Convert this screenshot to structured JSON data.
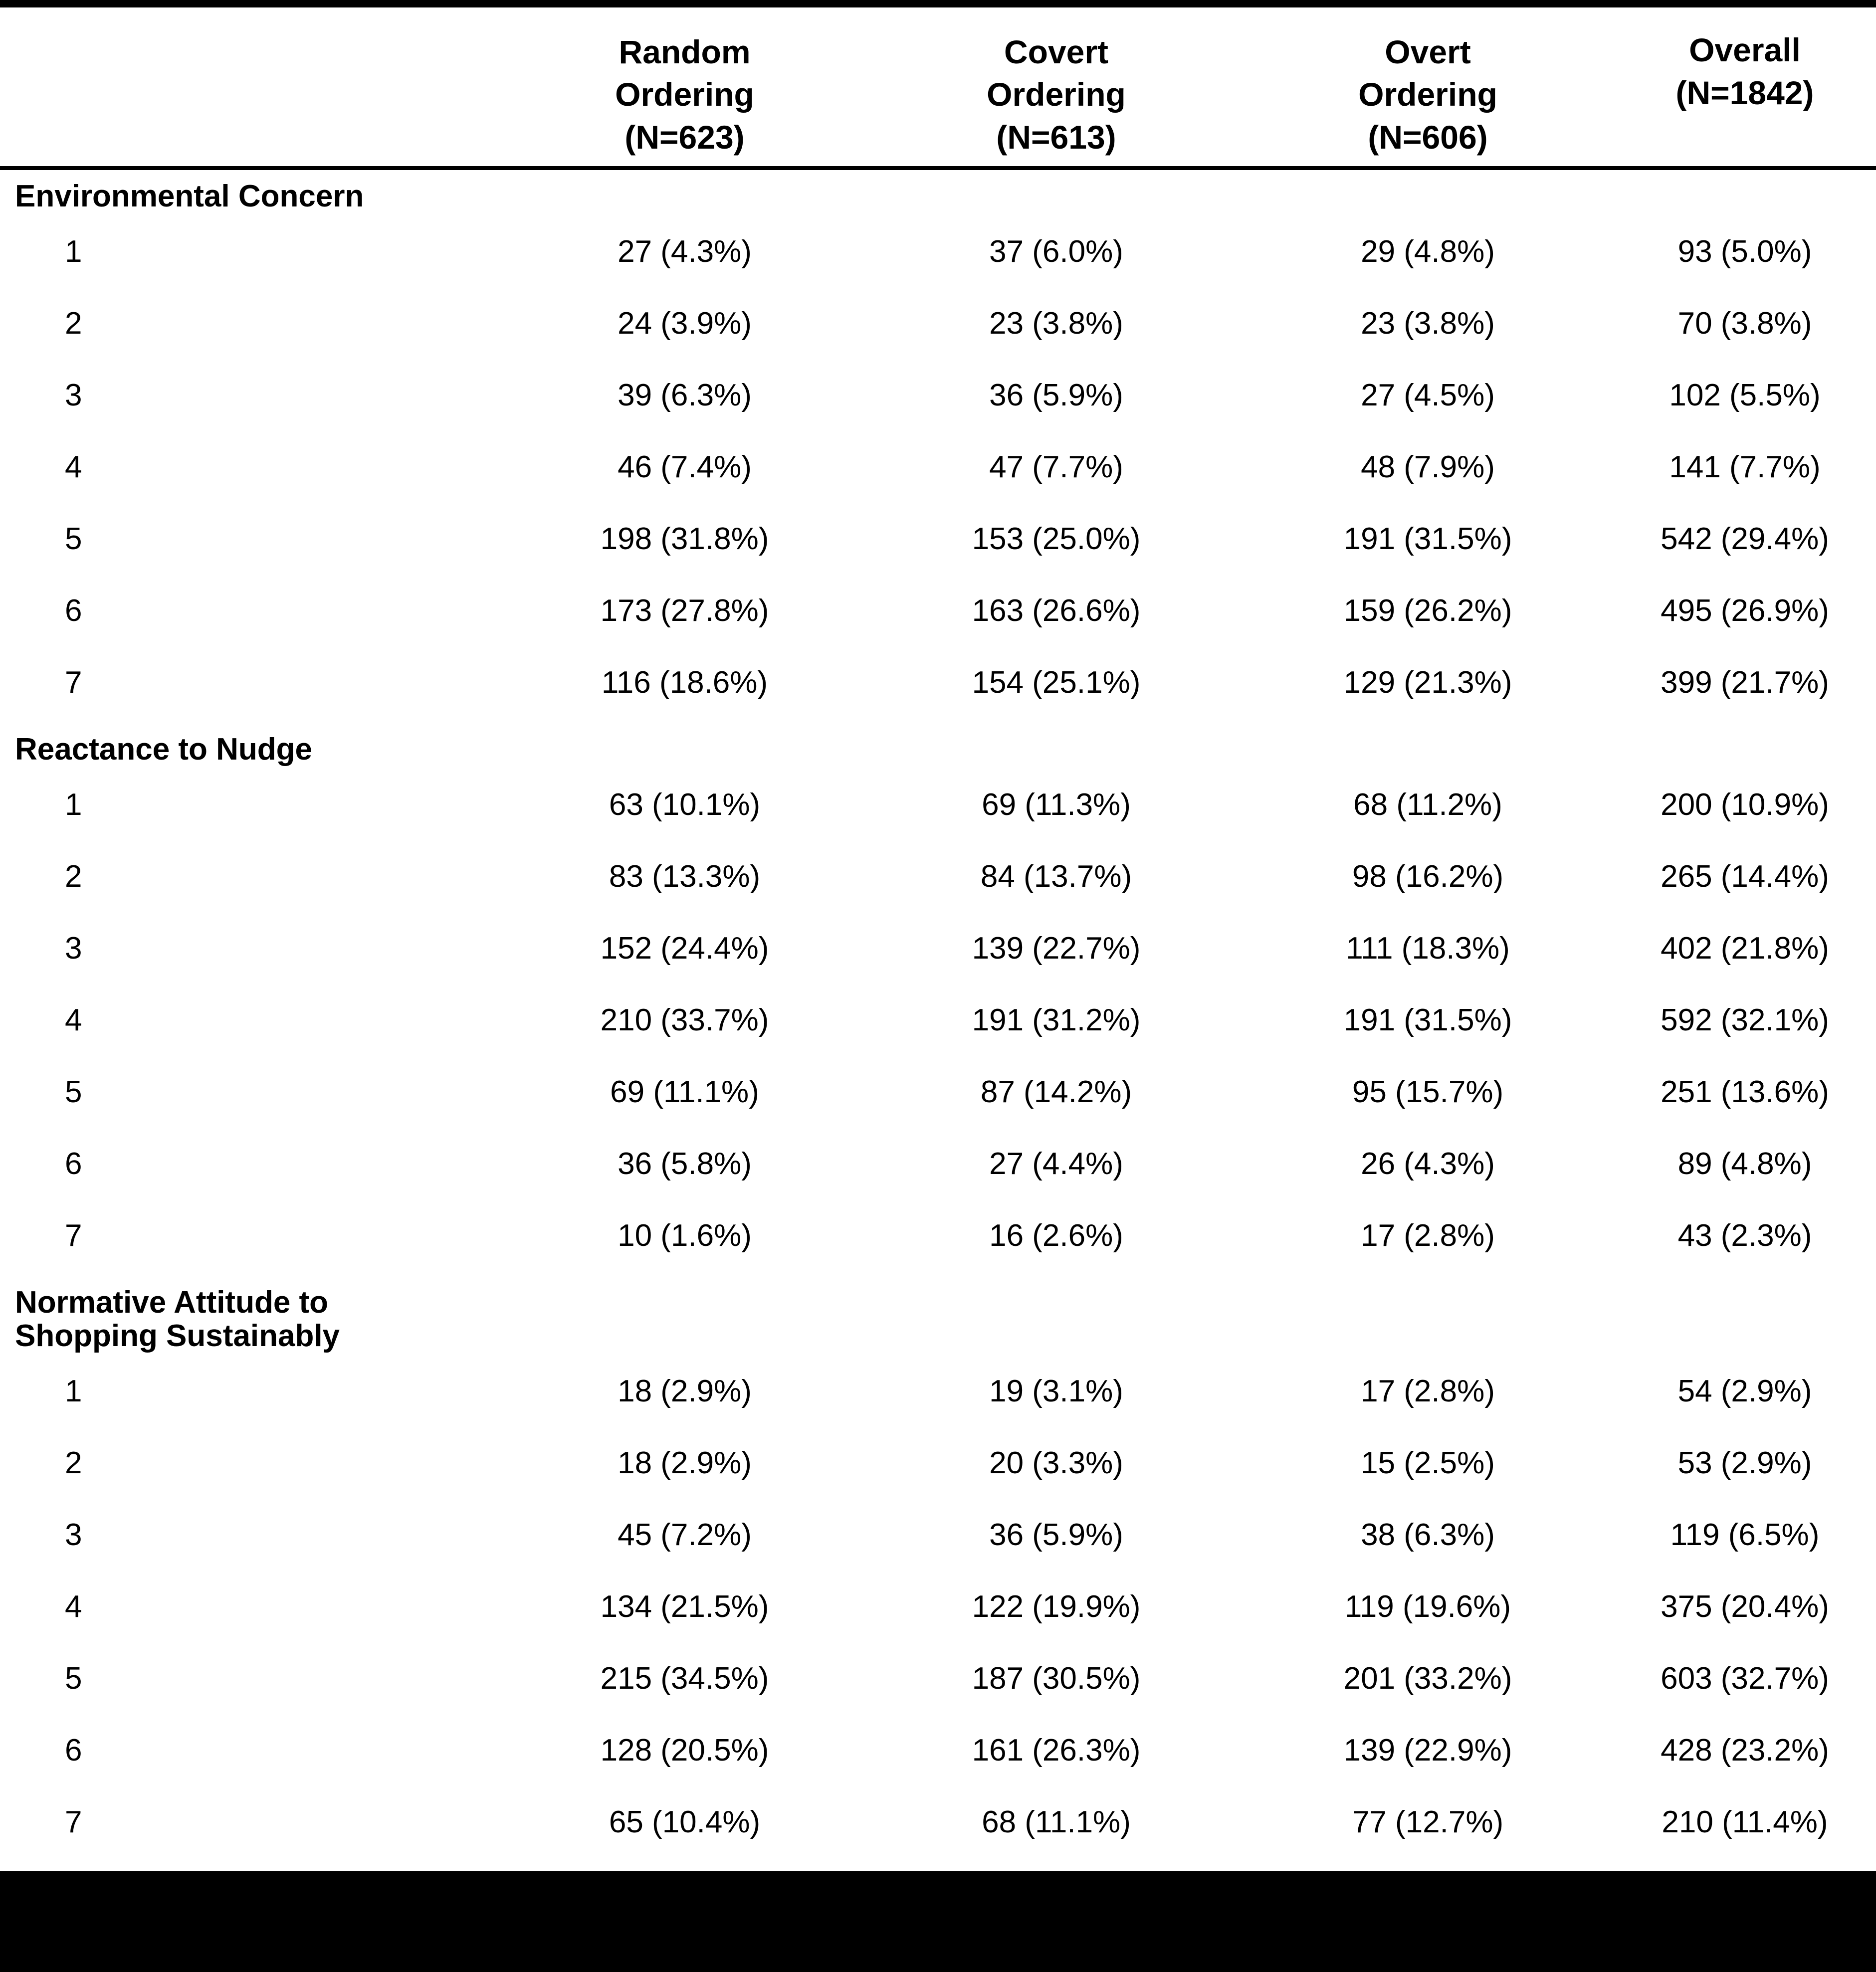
{
  "table": {
    "columns": [
      {
        "id": "label",
        "header_lines": []
      },
      {
        "id": "random",
        "header_lines": [
          "Random",
          "Ordering",
          "(N=623)"
        ]
      },
      {
        "id": "covert",
        "header_lines": [
          "Covert",
          "Ordering",
          "(N=613)"
        ]
      },
      {
        "id": "overt",
        "header_lines": [
          "Overt",
          "Ordering",
          "(N=606)"
        ]
      },
      {
        "id": "overall",
        "header_lines": [
          "Overall",
          "(N=1842)"
        ]
      }
    ],
    "header": {
      "random": {
        "l0": "Random",
        "l1": "Ordering",
        "l2": "(N=623)"
      },
      "covert": {
        "l0": "Covert",
        "l1": "Ordering",
        "l2": "(N=613)"
      },
      "overt": {
        "l0": "Overt",
        "l1": "Ordering",
        "l2": "(N=606)"
      },
      "overall": {
        "l0": "Overall",
        "l1": "(N=1842)"
      }
    },
    "sections": [
      {
        "title_lines": [
          "Environmental Concern"
        ],
        "rows": [
          {
            "label": "1",
            "random": "27 (4.3%)",
            "covert": "37 (6.0%)",
            "overt": "29 (4.8%)",
            "overall": "93 (5.0%)"
          },
          {
            "label": "2",
            "random": "24 (3.9%)",
            "covert": "23 (3.8%)",
            "overt": "23 (3.8%)",
            "overall": "70 (3.8%)"
          },
          {
            "label": "3",
            "random": "39 (6.3%)",
            "covert": "36 (5.9%)",
            "overt": "27 (4.5%)",
            "overall": "102 (5.5%)"
          },
          {
            "label": "4",
            "random": "46 (7.4%)",
            "covert": "47 (7.7%)",
            "overt": "48 (7.9%)",
            "overall": "141 (7.7%)"
          },
          {
            "label": "5",
            "random": "198 (31.8%)",
            "covert": "153 (25.0%)",
            "overt": "191 (31.5%)",
            "overall": "542 (29.4%)"
          },
          {
            "label": "6",
            "random": "173 (27.8%)",
            "covert": "163 (26.6%)",
            "overt": "159 (26.2%)",
            "overall": "495 (26.9%)"
          },
          {
            "label": "7",
            "random": "116 (18.6%)",
            "covert": "154 (25.1%)",
            "overt": "129 (21.3%)",
            "overall": "399 (21.7%)"
          }
        ]
      },
      {
        "title_lines": [
          "Reactance to Nudge"
        ],
        "rows": [
          {
            "label": "1",
            "random": "63 (10.1%)",
            "covert": "69 (11.3%)",
            "overt": "68 (11.2%)",
            "overall": "200 (10.9%)"
          },
          {
            "label": "2",
            "random": "83 (13.3%)",
            "covert": "84 (13.7%)",
            "overt": "98 (16.2%)",
            "overall": "265 (14.4%)"
          },
          {
            "label": "3",
            "random": "152 (24.4%)",
            "covert": "139 (22.7%)",
            "overt": "111 (18.3%)",
            "overall": "402 (21.8%)"
          },
          {
            "label": "4",
            "random": "210 (33.7%)",
            "covert": "191 (31.2%)",
            "overt": "191 (31.5%)",
            "overall": "592 (32.1%)"
          },
          {
            "label": "5",
            "random": "69 (11.1%)",
            "covert": "87 (14.2%)",
            "overt": "95 (15.7%)",
            "overall": "251 (13.6%)"
          },
          {
            "label": "6",
            "random": "36 (5.8%)",
            "covert": "27 (4.4%)",
            "overt": "26 (4.3%)",
            "overall": "89 (4.8%)"
          },
          {
            "label": "7",
            "random": "10 (1.6%)",
            "covert": "16 (2.6%)",
            "overt": "17 (2.8%)",
            "overall": "43 (2.3%)"
          }
        ]
      },
      {
        "title_lines": [
          "Normative Attitude to",
          "Shopping Sustainably"
        ],
        "rows": [
          {
            "label": "1",
            "random": "18 (2.9%)",
            "covert": "19 (3.1%)",
            "overt": "17 (2.8%)",
            "overall": "54 (2.9%)"
          },
          {
            "label": "2",
            "random": "18 (2.9%)",
            "covert": "20 (3.3%)",
            "overt": "15 (2.5%)",
            "overall": "53 (2.9%)"
          },
          {
            "label": "3",
            "random": "45 (7.2%)",
            "covert": "36 (5.9%)",
            "overt": "38 (6.3%)",
            "overall": "119 (6.5%)"
          },
          {
            "label": "4",
            "random": "134 (21.5%)",
            "covert": "122 (19.9%)",
            "overt": "119 (19.6%)",
            "overall": "375 (20.4%)"
          },
          {
            "label": "5",
            "random": "215 (34.5%)",
            "covert": "187 (30.5%)",
            "overt": "201 (33.2%)",
            "overall": "603 (32.7%)"
          },
          {
            "label": "6",
            "random": "128 (20.5%)",
            "covert": "161 (26.3%)",
            "overt": "139 (22.9%)",
            "overall": "428 (23.2%)"
          },
          {
            "label": "7",
            "random": "65 (10.4%)",
            "covert": "68 (11.1%)",
            "overt": "77 (12.7%)",
            "overall": "210 (11.4%)"
          }
        ]
      }
    ]
  }
}
